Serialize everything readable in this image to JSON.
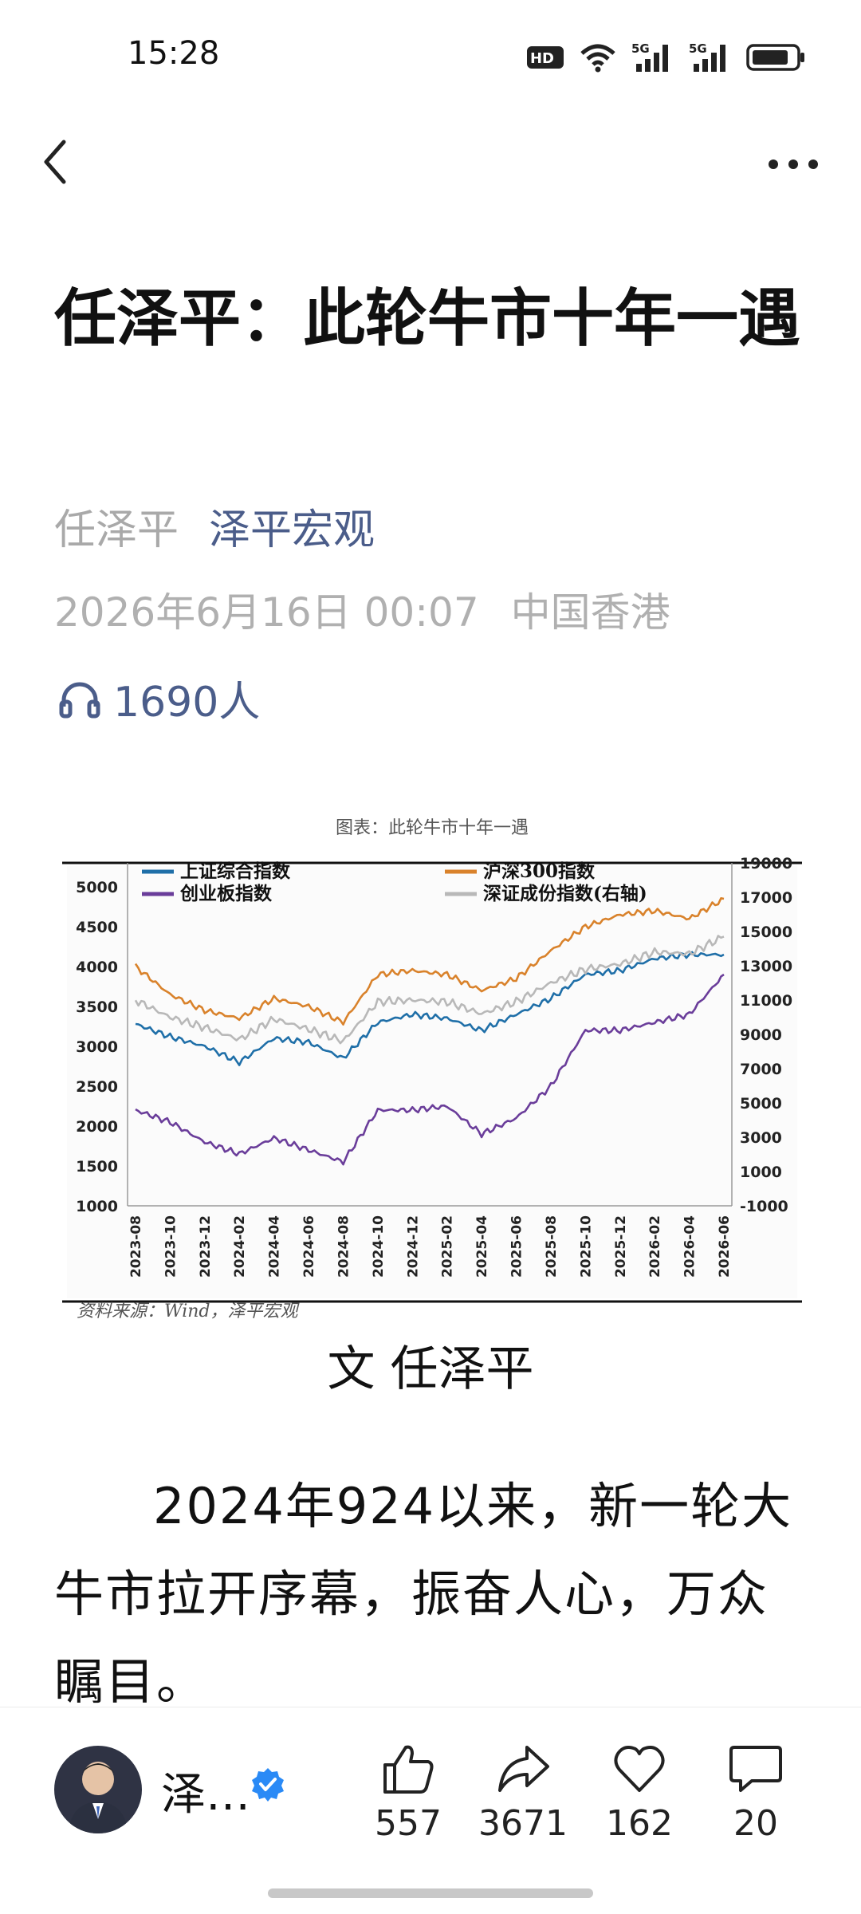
{
  "status_bar": {
    "time": "15:28",
    "icons": [
      "hd-icon",
      "wifi-icon",
      "5g-signal-icon",
      "5g-signal-icon",
      "battery-icon"
    ]
  },
  "nav": {
    "back_icon": "chevron-left-icon",
    "more_icon": "more-dots-icon"
  },
  "article": {
    "title": "任泽平：此轮牛市十年一遇",
    "author": "任泽平",
    "account": "泽平宏观",
    "datetime": "2026年6月16日 00:07",
    "location": "中国香港",
    "listeners": "1690人",
    "byline": "文  任泽平",
    "paragraph": "2024年924以来，新一轮大牛市拉开序幕，振奋人心，万众瞩目。"
  },
  "chart_data": {
    "type": "line",
    "title": "图表：此轮牛市十年一遇",
    "source": "资料来源：Wind，泽平宏观",
    "x": [
      "2023-08",
      "2023-10",
      "2023-12",
      "2024-02",
      "2024-04",
      "2024-06",
      "2024-08",
      "2024-10",
      "2024-12",
      "2025-02",
      "2025-04",
      "2025-06",
      "2025-08",
      "2025-10",
      "2025-12",
      "2026-02",
      "2026-04",
      "2026-06"
    ],
    "ylim_left": [
      1000,
      5000
    ],
    "yticks_left": [
      1000,
      1500,
      2000,
      2500,
      3000,
      3500,
      4000,
      4500,
      5000
    ],
    "ylim_right": [
      -1000,
      19000
    ],
    "yticks_right": [
      -1000,
      1000,
      3000,
      5000,
      7000,
      9000,
      11000,
      13000,
      15000,
      17000,
      19000
    ],
    "series": [
      {
        "name": "上证综合指数",
        "axis": "left",
        "color": "#1f6fa8",
        "values": [
          3280,
          3120,
          3000,
          2800,
          3100,
          3050,
          2850,
          3300,
          3400,
          3350,
          3200,
          3400,
          3600,
          3900,
          3950,
          4100,
          4150,
          4150
        ]
      },
      {
        "name": "沪深300指数",
        "axis": "left",
        "color": "#d9822b",
        "values": [
          4000,
          3650,
          3450,
          3350,
          3600,
          3500,
          3300,
          3900,
          3950,
          3900,
          3700,
          3850,
          4200,
          4500,
          4650,
          4700,
          4600,
          4850
        ]
      },
      {
        "name": "创业板指数",
        "axis": "left",
        "color": "#6a3d9a",
        "values": [
          2200,
          2050,
          1800,
          1650,
          1850,
          1700,
          1550,
          2200,
          2200,
          2250,
          1900,
          2100,
          2500,
          3200,
          3200,
          3300,
          3400,
          3900
        ]
      },
      {
        "name": "深证成份指数(右轴)",
        "axis": "right",
        "color": "#b8b8b8",
        "values": [
          11000,
          10000,
          9400,
          8700,
          9900,
          9300,
          8600,
          10900,
          11000,
          10900,
          10200,
          10900,
          12000,
          12800,
          13100,
          13800,
          13700,
          14700
        ]
      }
    ]
  },
  "bottom_bar": {
    "author_short": "泽…",
    "likes": "557",
    "shares": "3671",
    "favorites": "162",
    "comments": "20"
  },
  "colors": {
    "accent": "#4b5d8a",
    "muted": "#a9a9a9",
    "verified": "#2a8af6"
  }
}
